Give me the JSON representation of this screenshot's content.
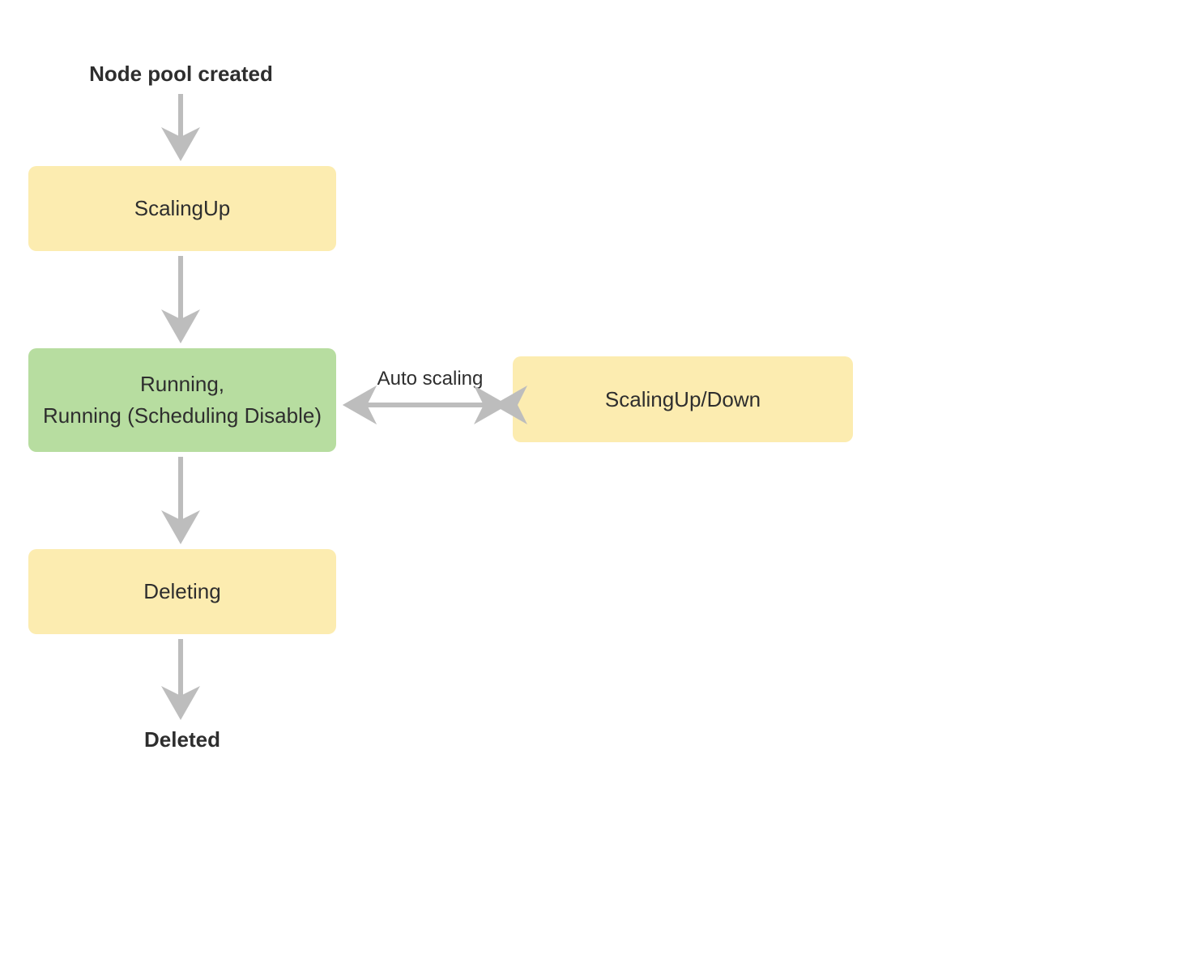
{
  "diagram": {
    "title_label": "Node pool created",
    "scalingup_label": "ScalingUp",
    "running_line1": "Running,",
    "running_line2": "Running (Scheduling Disable)",
    "auto_scaling_label": "Auto scaling",
    "scaling_updown_label": "ScalingUp/Down",
    "deleting_label": "Deleting",
    "deleted_label": "Deleted"
  },
  "colors": {
    "yellow": "#fcecb0",
    "green": "#b7dda0",
    "arrow": "#bdbdbd",
    "text": "#2e2e2e"
  }
}
